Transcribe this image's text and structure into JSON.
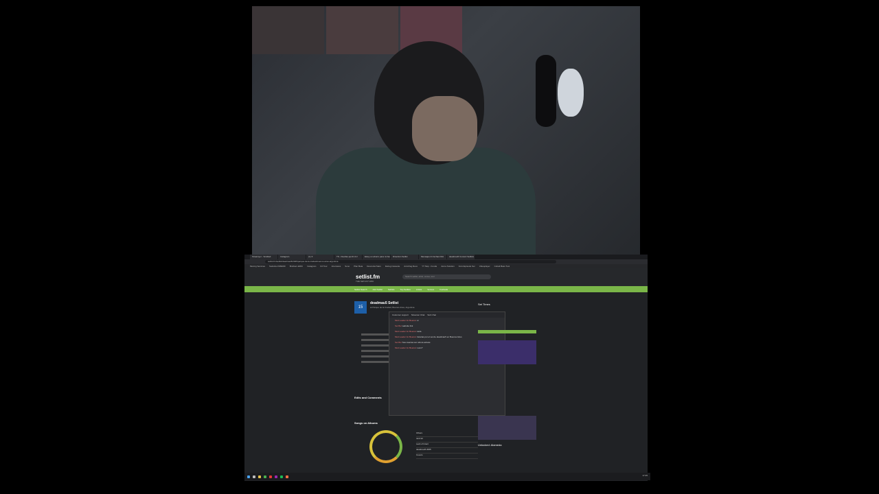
{
  "browser": {
    "tabs": [
      "Streamyer - Scuttled",
      "Instagram",
      "(1) X",
      "TS - Dueñas-up-DJ-CJ",
      "Estoy en ahorro para mi bucle",
      "Dirección Setlist",
      "Mensajes 21 fechas DJA",
      "deadmau5 Concert Setlists"
    ],
    "url": "setlist.fm/setlist/deadmau5/2025/parque-de-la-ciudad-buenos-aires-argentina",
    "bookmarks": [
      "Moving Services",
      "Sudocku FRIEND",
      "Brothers ERIC",
      "Instagram",
      "DJ Tour",
      "Interviews",
      "Sono",
      "Plan Beta",
      "Descontá Stars",
      "Debug Cassette",
      "Anti-Flag Reco",
      "YT Stop - Funda",
      "Just a Solution",
      "Forst Episode Ser",
      "Videoplayer",
      "Cobalt Bass Tool"
    ]
  },
  "site": {
    "logo": "setlist.fm",
    "logo_tagline": "THE SETLIST WIKI",
    "search_placeholder": "Search setlist, artist, venue, tour",
    "nav": [
      "Setlist Search",
      "Add Setlist",
      "Setlists",
      "Top Setlists",
      "Artists",
      "Venues",
      "Festivals",
      "Tours",
      "Search"
    ]
  },
  "setlist": {
    "date_day": "15",
    "title": "deadmau5 Setlist",
    "subtitle": "at Parque de la Ciudad, Buenos Aires, Argentina",
    "edits_title": "Edits and Comments",
    "songs_title": "Songs on Albums",
    "legend": [
      "Others",
      "4x4=12",
      "Lack of Intent",
      "deadmau5 2005",
      "Covers"
    ]
  },
  "chat": {
    "tabs": [
      "Customer support",
      "Streamer Chat",
      "Sub Chat"
    ],
    "messages": [
      {
        "who": "Mod Leader for Beacon",
        "text": "si"
      },
      {
        "who": "Set Bot",
        "text": "website link"
      },
      {
        "who": "Mod Leader for Beacon",
        "text": "Hola"
      },
      {
        "who": "Mod Leader for Beacon",
        "text": "Gracias por el set de deadmau5 en Buenos Aires"
      },
      {
        "who": "Set Bot",
        "text": "Sus cuentas son ahora activas"
      },
      {
        "who": "Mod Leader for Beacon",
        "text": "Loco?"
      }
    ]
  },
  "sidebar": {
    "set_times": "Set Times",
    "bottom_title": "Unlocked: Alameda"
  },
  "clock": "17:45"
}
